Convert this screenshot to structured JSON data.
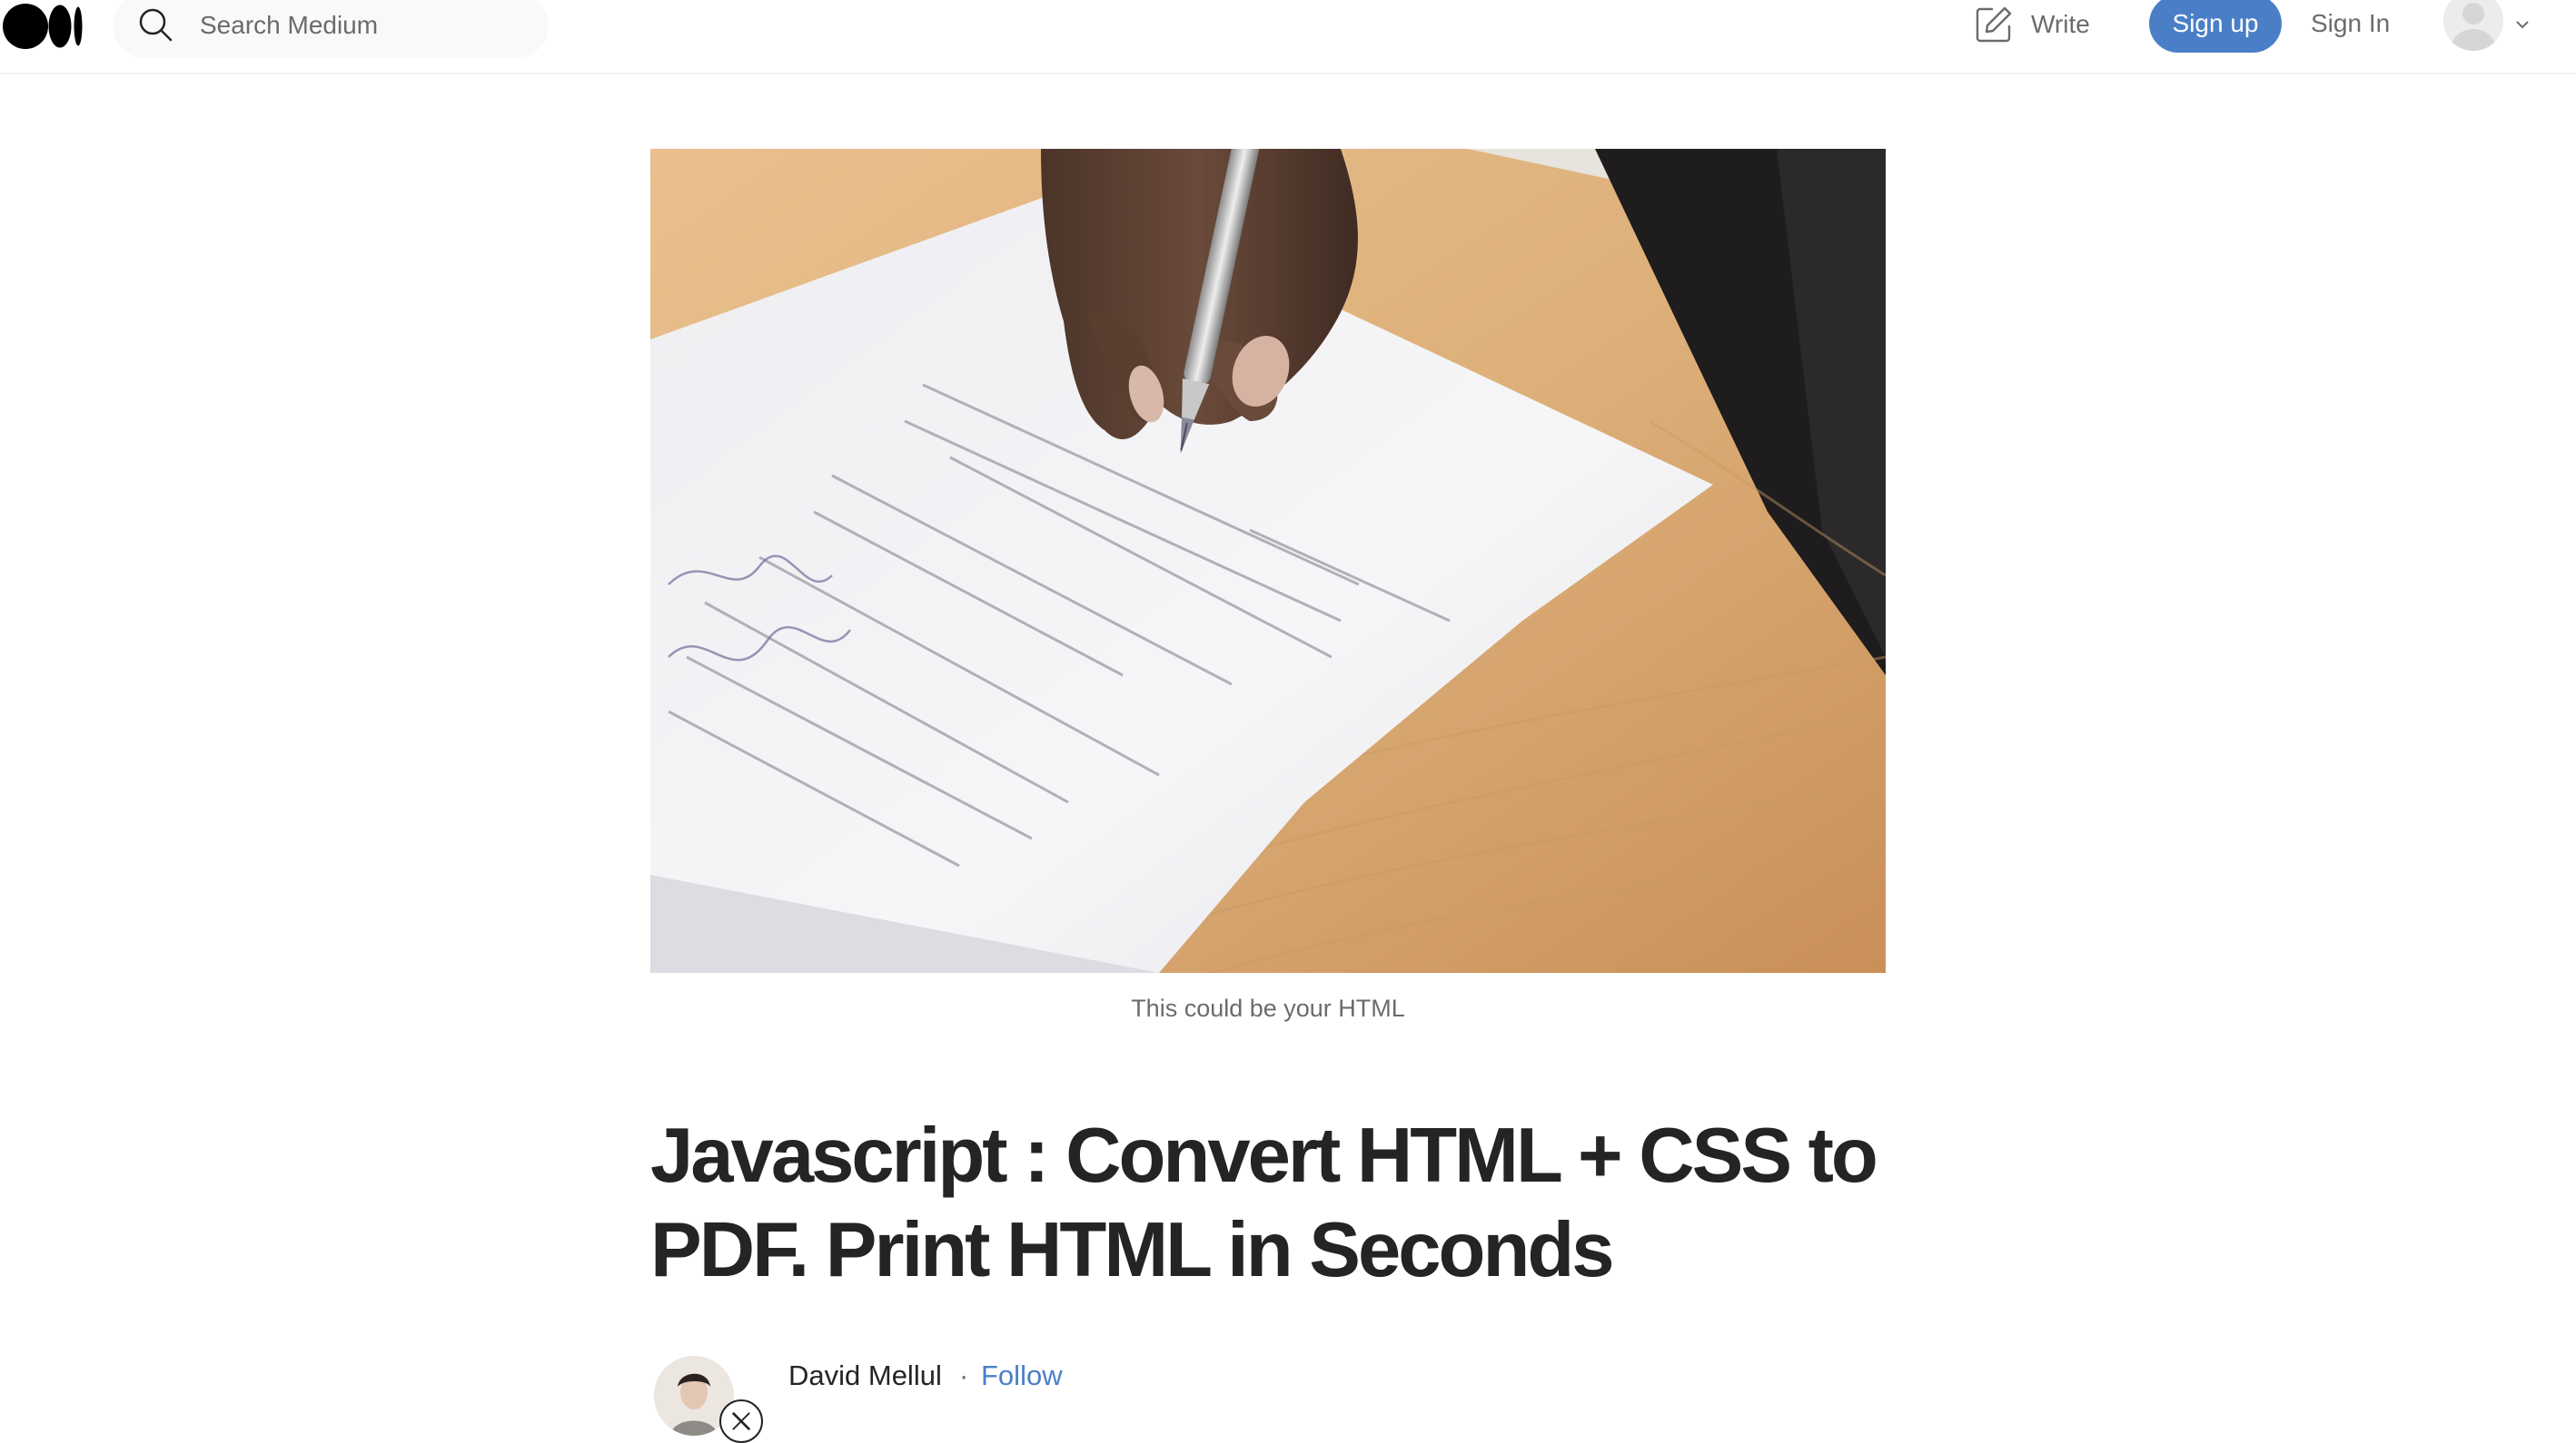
{
  "header": {
    "logo_icon": "medium-logo-icon",
    "search": {
      "icon": "search-icon",
      "placeholder": "Search Medium",
      "value": ""
    },
    "write": {
      "icon": "write-icon",
      "label": "Write"
    },
    "signup_label": "Sign up",
    "signin_label": "Sign In",
    "avatar_icon": "user-avatar-icon",
    "menu_icon": "chevron-down-icon",
    "accent_color": "#4a7fc7"
  },
  "article": {
    "hero_image": "photo of a hand signing a paper document with a fountain pen on a wooden desk",
    "caption": "This could be your HTML",
    "title": "Javascript : Convert HTML + CSS to PDF. Print HTML in Seconds",
    "author": {
      "name": "David Mellul",
      "separator": "·",
      "follow_label": "Follow",
      "badge_icon": "x-icon"
    }
  }
}
